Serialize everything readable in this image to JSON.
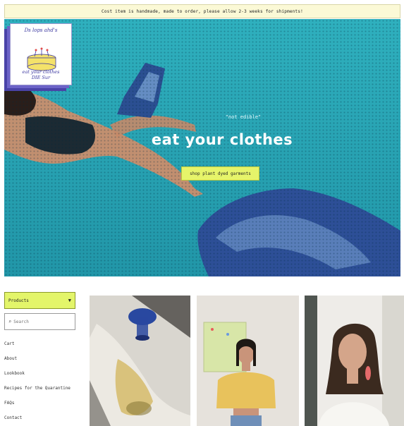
{
  "announcement": "Cost item is handmade, made to order, please allow 2-3 weeks for shipments!",
  "logo": {
    "top_text": "Ds lops ahd's",
    "bottom_text": "eat your clothes\nDIE Sur"
  },
  "hero": {
    "tagline": "\"not edible\"",
    "headline": "eat your clothes",
    "cta_label": "shop plant dyed garments"
  },
  "sidebar": {
    "dropdown_label": "Products",
    "search_placeholder": "Search",
    "links": [
      "Cart",
      "About",
      "Lookbook",
      "Recipes for the Quarantine",
      "FAQs",
      "Contact"
    ]
  },
  "colors": {
    "hero_bg": "#2aa7b5",
    "accent_yellow": "#e3f56a",
    "announcement_bg": "#fbf9d6"
  }
}
